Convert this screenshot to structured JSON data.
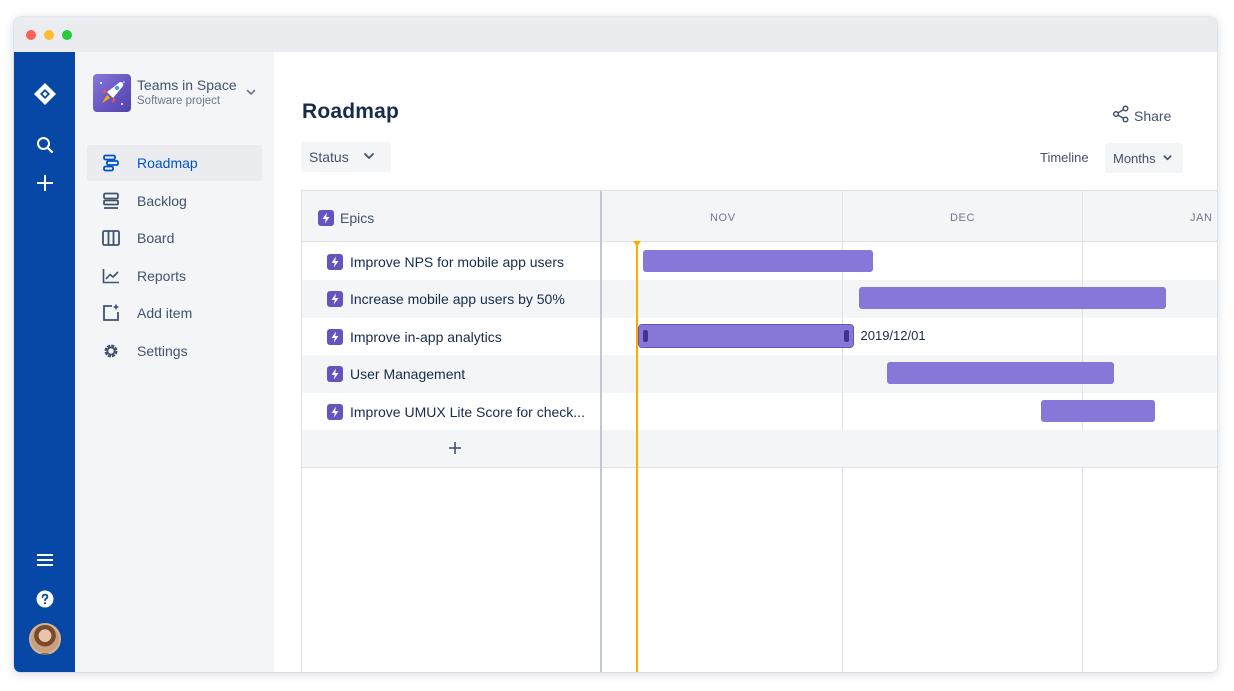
{
  "window": {
    "controls": [
      "close",
      "minimize",
      "maximize"
    ]
  },
  "global_nav": {
    "icons": [
      "jira-logo-icon",
      "search-icon",
      "create-icon",
      "menu-icon",
      "help-icon",
      "user-avatar"
    ]
  },
  "project": {
    "name": "Teams in Space",
    "type": "Software project"
  },
  "sidebar": {
    "items": [
      {
        "label": "Roadmap",
        "icon": "roadmap-icon",
        "active": true
      },
      {
        "label": "Backlog",
        "icon": "backlog-icon",
        "active": false
      },
      {
        "label": "Board",
        "icon": "board-icon",
        "active": false
      },
      {
        "label": "Reports",
        "icon": "reports-icon",
        "active": false
      },
      {
        "label": "Add item",
        "icon": "add-item-icon",
        "active": false
      },
      {
        "label": "Settings",
        "icon": "settings-icon",
        "active": false
      }
    ]
  },
  "header": {
    "title": "Roadmap",
    "share_label": "Share",
    "status_label": "Status",
    "timeline_label": "Timeline",
    "months_label": "Months"
  },
  "roadmap": {
    "epics_header": "Epics",
    "months": [
      "NOV",
      "DEC",
      "JAN"
    ],
    "epics": [
      {
        "label": "Improve NPS for mobile app users",
        "start": 0.0667,
        "end": 0.44
      },
      {
        "label": "Increase mobile app users by 50%",
        "start": 0.4167,
        "end": 0.915
      },
      {
        "label": "Improve in-app analytics",
        "start": 0.06,
        "end": 0.4067,
        "date_label": "2019/12/01",
        "selected": true
      },
      {
        "label": "User Management",
        "start": 0.4633,
        "end": 0.8317
      },
      {
        "label": "Improve UMUX Lite Score for check...",
        "start": 0.7133,
        "end": 0.8983
      }
    ],
    "today": 0.055
  },
  "colors": {
    "nav_blue": "#0747A6",
    "bar_purple": "#8777D9",
    "epic_purple": "#6554C0",
    "today_line": "#FFAB00",
    "active_link": "#0052CC"
  }
}
